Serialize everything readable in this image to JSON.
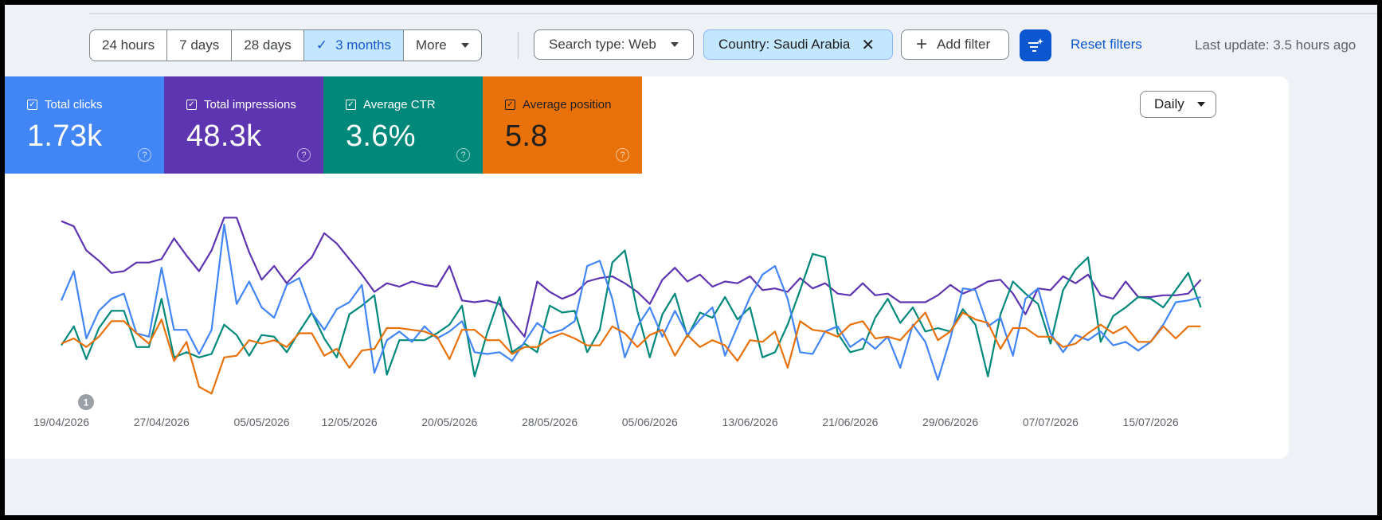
{
  "toolbar": {
    "ranges": [
      "24 hours",
      "7 days",
      "28 days",
      "3 months",
      "More"
    ],
    "active_range": "3 months",
    "search_type": "Search type: Web",
    "country_filter": "Country: Saudi Arabia",
    "add_filter": "Add filter",
    "reset_filters": "Reset filters",
    "last_update": "Last update: 3.5 hours ago"
  },
  "metrics": [
    {
      "label": "Total clicks",
      "value": "1.73k",
      "color": "#4285f4"
    },
    {
      "label": "Total impressions",
      "value": "48.3k",
      "color": "#5e35b1"
    },
    {
      "label": "Average CTR",
      "value": "3.6%",
      "color": "#00897b"
    },
    {
      "label": "Average position",
      "value": "5.8",
      "color": "#e8710a"
    }
  ],
  "granularity": "Daily",
  "annotation": {
    "label": "1",
    "date": "19/04/2026"
  },
  "chart_data": {
    "type": "line",
    "x_start": "19/04/2026",
    "x_ticks": [
      "19/04/2026",
      "27/04/2026",
      "05/05/2026",
      "12/05/2026",
      "20/05/2026",
      "28/05/2026",
      "05/06/2026",
      "13/06/2026",
      "21/06/2026",
      "29/06/2026",
      "07/07/2026",
      "15/07/2026"
    ],
    "x_tick_days": [
      0,
      8,
      16,
      23,
      31,
      39,
      47,
      55,
      63,
      71,
      79,
      87
    ],
    "grid": false,
    "y_axis_labels": "hidden",
    "series": [
      {
        "name": "Total impressions",
        "color": "#5e35b1",
        "values": [
          690,
          687,
          673,
          667,
          660,
          661,
          666,
          666,
          668,
          680,
          670,
          661,
          673,
          692,
          692,
          672,
          656,
          664,
          654,
          662,
          669,
          683,
          677,
          668,
          659,
          649,
          654,
          652,
          655,
          653,
          652,
          664,
          644,
          643,
          644,
          642,
          632,
          623,
          655,
          649,
          645,
          648,
          655,
          657,
          658,
          654,
          649,
          642,
          656,
          663,
          655,
          659,
          652,
          655,
          654,
          658,
          650,
          651,
          649,
          657,
          651,
          654,
          648,
          647,
          654,
          647,
          648,
          643,
          643,
          643,
          647,
          653,
          648,
          651,
          655,
          656,
          648,
          636,
          651,
          650,
          658,
          654,
          659,
          647,
          645,
          655,
          646,
          646,
          647,
          647,
          648,
          656
        ]
      },
      {
        "name": "Total clicks",
        "color": "#4285f4",
        "values": [
          644,
          661,
          622,
          638,
          645,
          648,
          625,
          623,
          663,
          627,
          627,
          613,
          627,
          688,
          642,
          655,
          640,
          634,
          653,
          657,
          637,
          627,
          639,
          643,
          653,
          602,
          621,
          626,
          620,
          629,
          622,
          626,
          632,
          614,
          613,
          614,
          609,
          620,
          631,
          625,
          627,
          632,
          664,
          667,
          645,
          611,
          629,
          640,
          623,
          638,
          624,
          633,
          640,
          612,
          629,
          646,
          659,
          664,
          645,
          614,
          613,
          626,
          629,
          617,
          622,
          616,
          623,
          605,
          630,
          620,
          598,
          622,
          651,
          650,
          629,
          634,
          612,
          645,
          651,
          625,
          614,
          624,
          621,
          626,
          618,
          620,
          615,
          620,
          630,
          643,
          644,
          646
        ]
      },
      {
        "name": "Average CTR",
        "color": "#00897b",
        "values": [
          618,
          629,
          610,
          628,
          638,
          638,
          617,
          617,
          645,
          611,
          614,
          611,
          613,
          630,
          624,
          612,
          624,
          623,
          614,
          626,
          637,
          622,
          611,
          636,
          641,
          647,
          601,
          621,
          621,
          621,
          625,
          630,
          641,
          600,
          625,
          646,
          614,
          619,
          614,
          641,
          637,
          638,
          614,
          627,
          666,
          673,
          638,
          611,
          636,
          648,
          623,
          637,
          634,
          646,
          633,
          640,
          611,
          614,
          630,
          650,
          671,
          669,
          625,
          614,
          616,
          634,
          645,
          631,
          640,
          626,
          628,
          626,
          639,
          630,
          600,
          636,
          655,
          648,
          642,
          619,
          650,
          662,
          669,
          620,
          635,
          640,
          646,
          645,
          640,
          650,
          660,
          640
        ]
      },
      {
        "name": "Average position",
        "color": "#e8710a",
        "values": [
          619,
          622,
          617,
          623,
          632,
          632,
          625,
          619,
          633,
          609,
          620,
          594,
          590,
          611,
          612,
          621,
          619,
          621,
          617,
          625,
          625,
          612,
          616,
          605,
          615,
          616,
          628,
          628,
          627,
          626,
          623,
          610,
          627,
          627,
          621,
          621,
          613,
          617,
          617,
          622,
          625,
          622,
          618,
          618,
          629,
          625,
          617,
          624,
          627,
          612,
          624,
          617,
          621,
          618,
          609,
          621,
          620,
          626,
          605,
          632,
          627,
          626,
          623,
          630,
          632,
          622,
          623,
          621,
          629,
          637,
          621,
          626,
          637,
          633,
          631,
          616,
          628,
          628,
          623,
          623,
          617,
          619,
          625,
          630,
          625,
          629,
          620,
          620,
          629,
          622,
          629,
          629
        ]
      }
    ]
  }
}
